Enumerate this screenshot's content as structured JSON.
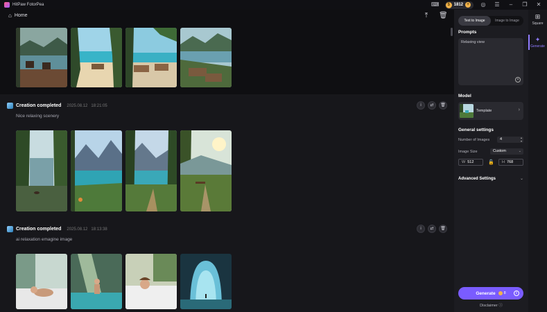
{
  "app": {
    "title": "HitPaw FotorPea"
  },
  "titlebar": {
    "credits": "1812",
    "coin_symbol": "$",
    "plus": "+"
  },
  "nav": {
    "home_label": "Home"
  },
  "blocks": [
    {
      "title": "Creation completed",
      "date": "2025.08.12",
      "time": "18:21:05",
      "prompt": "Nice relaxing scenery"
    },
    {
      "title": "Creation completed",
      "date": "2025.08.12",
      "time": "18:13:38",
      "prompt": "ai relaxation emagine image"
    }
  ],
  "panel": {
    "tabs": [
      "Text to Image",
      "Image to Image"
    ],
    "active_tab": "Text to Image",
    "prompts_label": "Prompts",
    "prompt_value": "Relaxing view",
    "model_label": "Model",
    "model_name": "Template",
    "general_settings_label": "General settings",
    "num_images_label": "Number of Images",
    "num_images_value": "4",
    "image_size_label": "Image Size",
    "image_size_value": "Custom",
    "width_label": "W",
    "width_value": "512",
    "height_label": "H",
    "height_value": "768",
    "advanced_label": "Advanced Settings",
    "generate_label": "Generate",
    "generate_cost": "8",
    "disclaimer_label": "Disclaimer"
  },
  "rail": {
    "items": [
      {
        "label": "Square",
        "icon": "grid-icon"
      },
      {
        "label": "Generate",
        "icon": "sparkle-icon"
      }
    ]
  },
  "colors": {
    "accent": "#7a5cff",
    "background": "#0f0f12",
    "panel": "#1c1c21"
  }
}
